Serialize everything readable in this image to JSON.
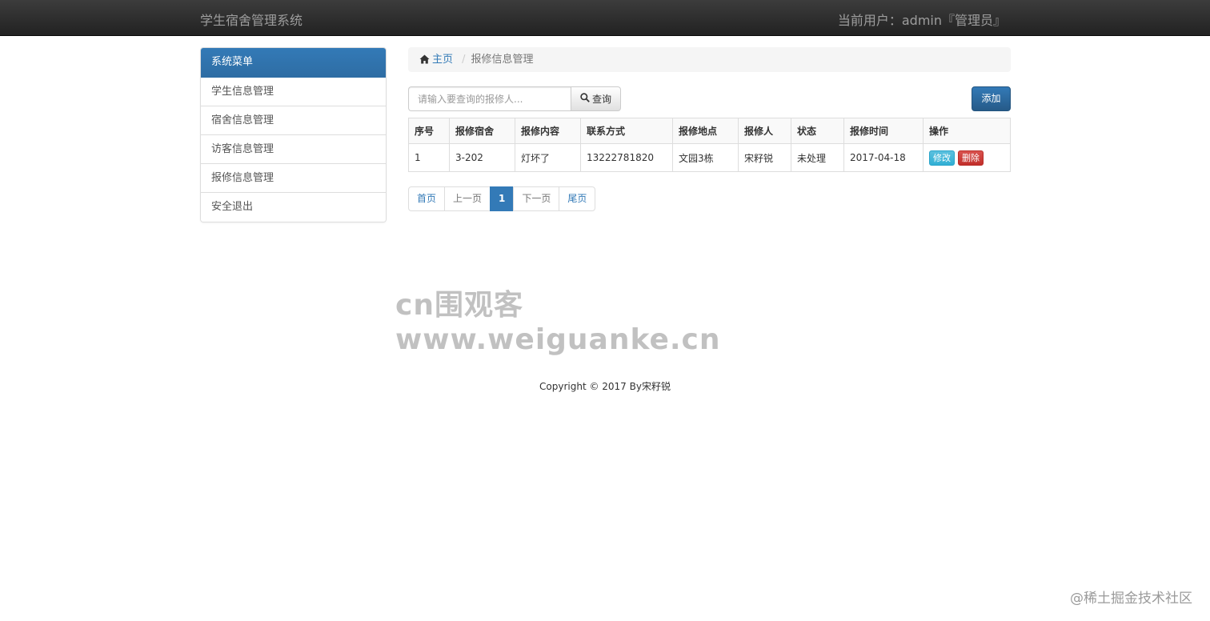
{
  "navbar": {
    "brand": "学生宿舍管理系统",
    "user_info": "当前用户：admin『管理员』"
  },
  "sidebar": {
    "header": "系统菜单",
    "items": [
      {
        "label": "学生信息管理"
      },
      {
        "label": "宿舍信息管理"
      },
      {
        "label": "访客信息管理"
      },
      {
        "label": "报修信息管理"
      },
      {
        "label": "安全退出"
      }
    ]
  },
  "breadcrumb": {
    "home": "主页",
    "separator": "/",
    "current": "报修信息管理"
  },
  "search": {
    "placeholder": "请输入要查询的报修人...",
    "button_label": "查询"
  },
  "toolbar": {
    "add_label": "添加"
  },
  "table": {
    "headers": [
      "序号",
      "报修宿舍",
      "报修内容",
      "联系方式",
      "报修地点",
      "报修人",
      "状态",
      "报修时间",
      "操作"
    ],
    "rows": [
      {
        "index": "1",
        "dorm": "3-202",
        "content": "灯坏了",
        "phone": "13222781820",
        "location": "文园3栋",
        "reporter": "宋籽锐",
        "status": "未处理",
        "time": "2017-04-18",
        "edit_label": "修改",
        "delete_label": "删除"
      }
    ]
  },
  "pagination": {
    "first": "首页",
    "prev": "上一页",
    "current": "1",
    "next": "下一页",
    "last": "尾页"
  },
  "watermark": {
    "center": "cn围观客www.weiguanke.cn",
    "corner": "@稀土掘金技术社区"
  },
  "footer": {
    "copyright": "Copyright © 2017 By宋籽锐"
  },
  "colors": {
    "primary": "#337ab7",
    "navbar_bg": "#222222",
    "info": "#5bc0de",
    "danger": "#d9534f"
  },
  "icons": [
    "home-icon",
    "search-icon"
  ]
}
